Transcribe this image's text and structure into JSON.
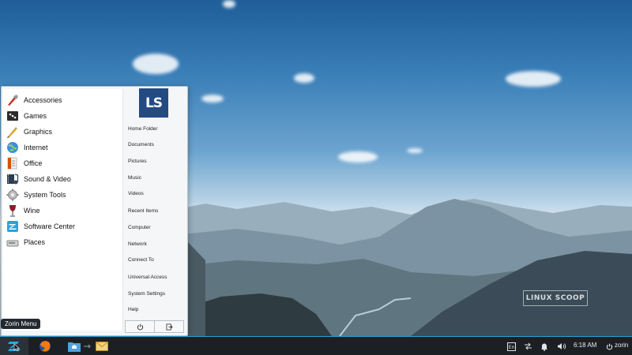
{
  "menu": {
    "categories": [
      {
        "label": "Accessories",
        "icon": "accessories-icon"
      },
      {
        "label": "Games",
        "icon": "games-icon"
      },
      {
        "label": "Graphics",
        "icon": "graphics-icon"
      },
      {
        "label": "Internet",
        "icon": "internet-icon"
      },
      {
        "label": "Office",
        "icon": "office-icon"
      },
      {
        "label": "Sound & Video",
        "icon": "sound-video-icon"
      },
      {
        "label": "System Tools",
        "icon": "system-tools-icon"
      },
      {
        "label": "Wine",
        "icon": "wine-icon"
      },
      {
        "label": "Software Center",
        "icon": "software-center-icon"
      },
      {
        "label": "Places",
        "icon": "places-icon"
      }
    ],
    "avatar_text": "LS",
    "places": [
      "Home Folder",
      "Documents",
      "Pictures",
      "Music",
      "Videos",
      "Recent Items",
      "Computer",
      "Network",
      "Connect To",
      "Universal Access",
      "System Settings",
      "Help"
    ]
  },
  "tooltip": "Zorin Menu",
  "watermark": "LINUX SCOOP",
  "panel": {
    "clock": "6:18 AM",
    "user": "zorin",
    "launchers": [
      "firefox-icon",
      "files-icon",
      "mail-icon"
    ],
    "tray": [
      "keyboard-icon",
      "network-icon",
      "notification-bell-icon",
      "volume-icon"
    ]
  },
  "colors": {
    "panel_bg": "#1b2024",
    "accent": "#2a9fd8",
    "avatar_bg": "#244a82"
  }
}
